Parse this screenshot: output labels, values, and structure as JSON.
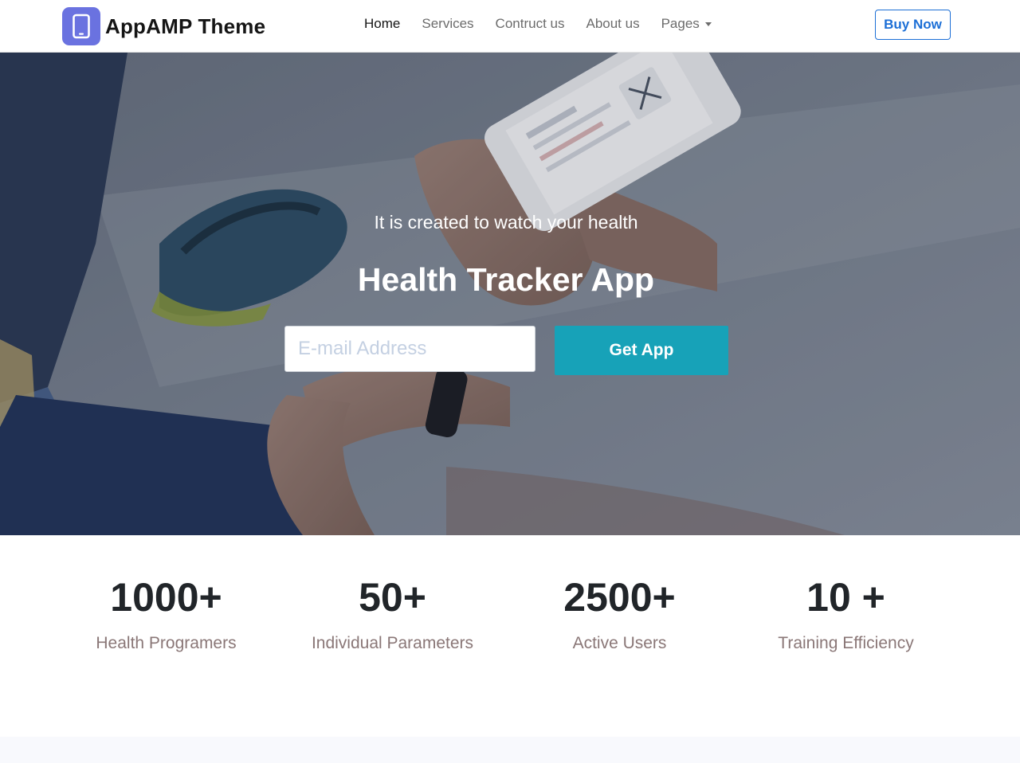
{
  "brand": {
    "name": "AppAMP Theme",
    "icon": "smartphone-icon",
    "icon_color": "#6a72e0"
  },
  "nav": {
    "items": [
      {
        "label": "Home",
        "active": true
      },
      {
        "label": "Services",
        "active": false
      },
      {
        "label": "Contruct us",
        "active": false
      },
      {
        "label": "About us",
        "active": false
      },
      {
        "label": "Pages",
        "active": false,
        "dropdown": true
      }
    ],
    "cta_label": "Buy Now",
    "cta_color": "#1c6fd6"
  },
  "hero": {
    "subtitle": "It is created to watch your health",
    "title": "Health Tracker App",
    "email_placeholder": "E-mail Address",
    "button_label": "Get App",
    "button_color": "#17a2b8"
  },
  "stats": [
    {
      "value": "1000+",
      "label": "Health Programers"
    },
    {
      "value": "50+",
      "label": "Individual Parameters"
    },
    {
      "value": "2500+",
      "label": "Active Users"
    },
    {
      "value": "10 +",
      "label": "Training Efficiency"
    }
  ]
}
